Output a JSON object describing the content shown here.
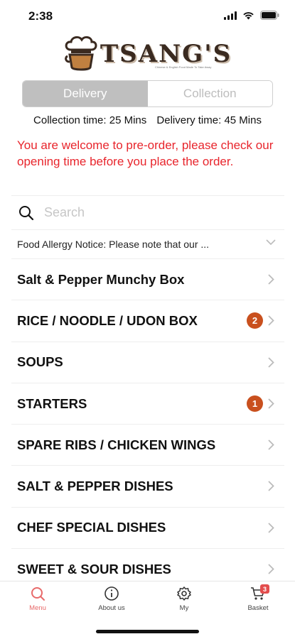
{
  "status_bar": {
    "time": "2:38"
  },
  "logo": {
    "text": "TSANG'S",
    "subtitle": "Chinese & English Food Made To Take Away"
  },
  "order_type": {
    "options": [
      "Delivery",
      "Collection"
    ],
    "selected": "Delivery"
  },
  "times": {
    "collection": "Collection time: 25 Mins",
    "delivery": "Delivery time: 45 Mins"
  },
  "notice": "You are welcome to pre-order, please check our opening time before you place the order.",
  "search": {
    "placeholder": "Search"
  },
  "allergy": {
    "text": "Food Allergy Notice: Please note that our ..."
  },
  "menu": {
    "items": [
      {
        "label": "Salt & Pepper Munchy Box",
        "badge": ""
      },
      {
        "label": "RICE / NOODLE / UDON BOX",
        "badge": "2"
      },
      {
        "label": "SOUPS",
        "badge": ""
      },
      {
        "label": "STARTERS",
        "badge": "1"
      },
      {
        "label": "SPARE RIBS / CHICKEN WINGS",
        "badge": ""
      },
      {
        "label": "SALT & PEPPER DISHES",
        "badge": ""
      },
      {
        "label": "CHEF SPECIAL DISHES",
        "badge": ""
      },
      {
        "label": "SWEET & SOUR DISHES",
        "badge": ""
      }
    ]
  },
  "tabbar": {
    "tabs": [
      {
        "label": "Menu",
        "icon": "search-icon",
        "active": true
      },
      {
        "label": "About us",
        "icon": "info-icon",
        "active": false
      },
      {
        "label": "My",
        "icon": "gear-icon",
        "active": false
      },
      {
        "label": "Basket",
        "icon": "cart-icon",
        "active": false
      }
    ],
    "basket_count": "3"
  },
  "colors": {
    "accent": "#e8252c",
    "badge": "#c9501e",
    "active_tab": "#e86a6a",
    "segment_active": "#bfbfbf"
  }
}
